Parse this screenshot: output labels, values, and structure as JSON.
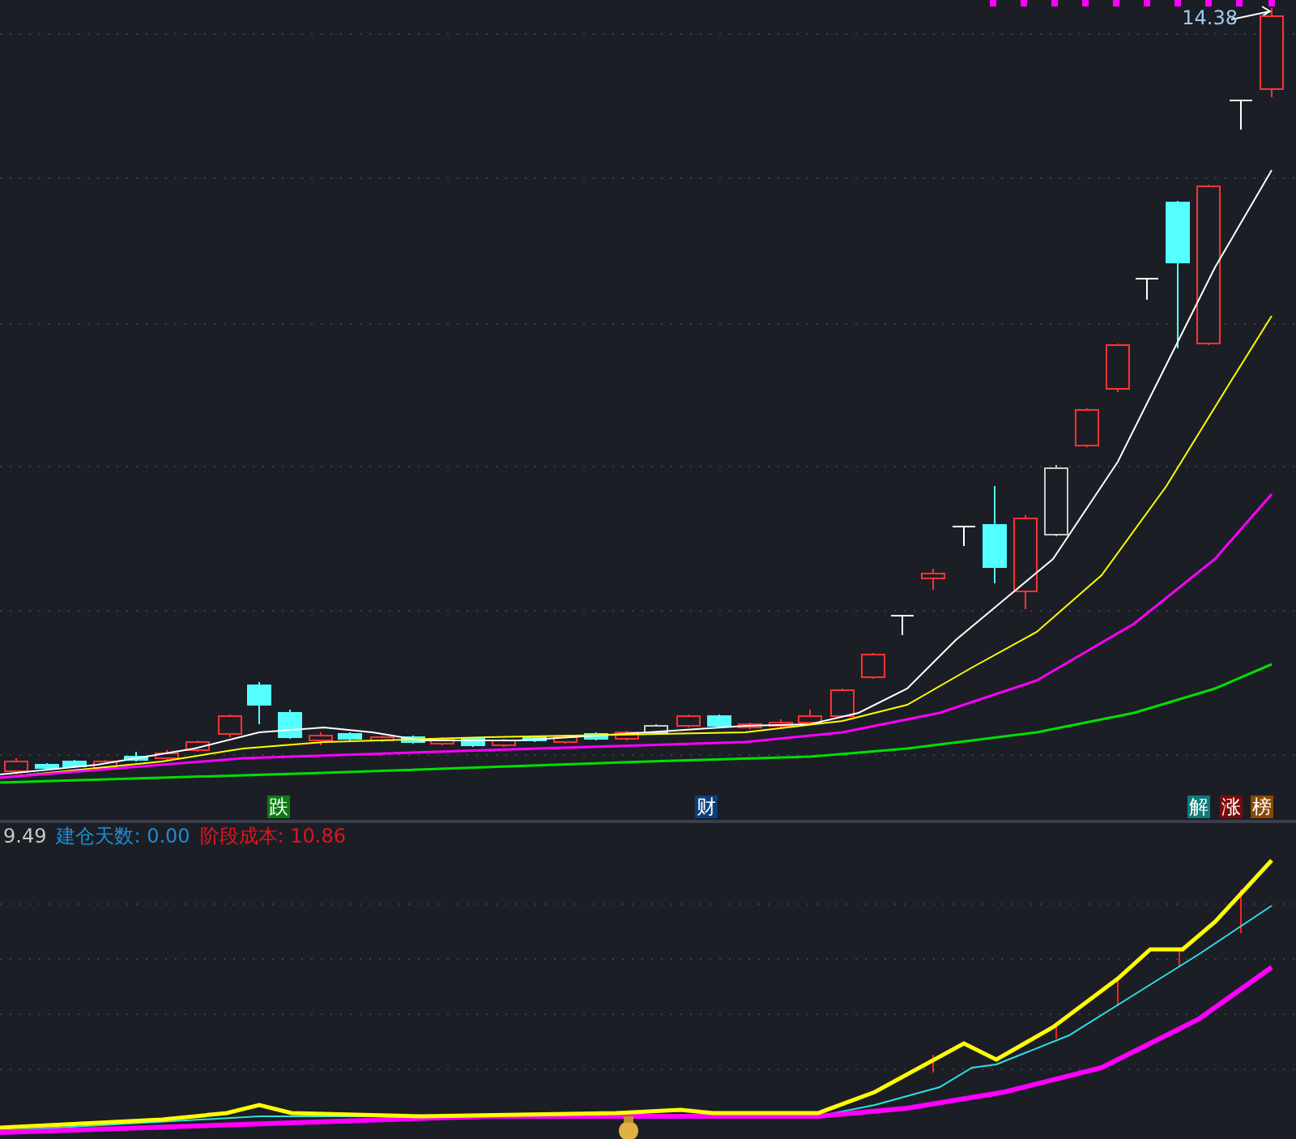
{
  "main_chart": {
    "price_label": "14.38",
    "signals": [
      {
        "text": "跌",
        "color": "#0b7d12"
      },
      {
        "text": "财",
        "color": "#0b3f7a"
      },
      {
        "text": "解",
        "color": "#0b7b7b"
      },
      {
        "text": "涨",
        "color": "#7d0a0a"
      },
      {
        "text": "榜",
        "color": "#8a4a00"
      }
    ]
  },
  "indicator": {
    "readings": [
      {
        "text": "9.49",
        "color": "#c8c8c8"
      },
      {
        "text": "建仓天数: 0.00",
        "color": "#1a8fd6"
      },
      {
        "text": "阶段成本: 10.86",
        "color": "#e0161b"
      }
    ]
  }
}
